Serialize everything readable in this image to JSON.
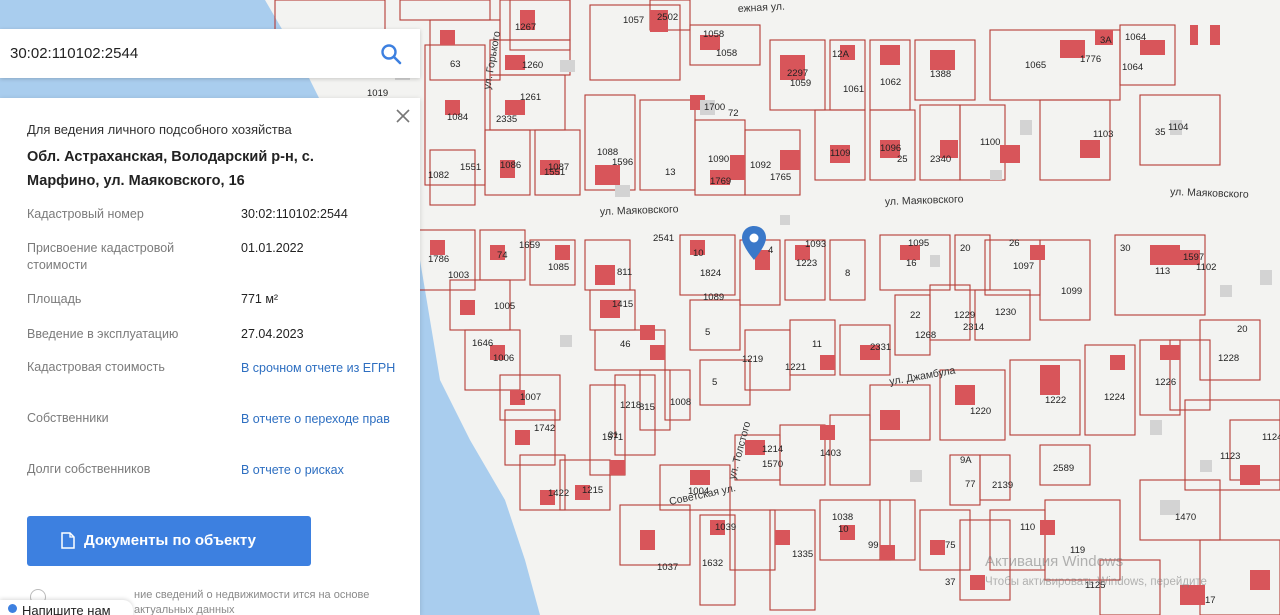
{
  "search": {
    "value": "30:02:110102:2544"
  },
  "parcel": {
    "purpose": "Для ведения личного подсобного хозяйства",
    "address": "Обл. Астраханская, Володарский р-н, с. Марфино, ул. Маяковского, 16",
    "rows": [
      {
        "label": "Кадастровый номер",
        "value": "30:02:110102:2544"
      },
      {
        "label": "Присвоение кадастровой стоимости",
        "value": "01.01.2022"
      },
      {
        "label": "Площадь",
        "value": "771 м²"
      },
      {
        "label": "Введение в эксплуатацию",
        "value": "27.04.2023"
      },
      {
        "label": "Кадастровая стоимость",
        "link": "В срочном отчете из ЕГРН"
      },
      {
        "label": "Собственники",
        "link": "В отчете о переходе прав"
      },
      {
        "label": "Долги собственников",
        "link": "В отчете о рисках"
      }
    ],
    "docs_button": "Документы по объекту",
    "footnote": "ние сведений о недвижимости ится на основе актуальных данных"
  },
  "chat": {
    "label": "Напишите нам"
  },
  "watermark": {
    "line1": "Активация Windows",
    "line2": "Чтобы активировать Windows, перейдите"
  },
  "map": {
    "streets": [
      "ул. Маяковского",
      "ул. Маяковского",
      "ул. Маяковского",
      "ул. Джамбула",
      "Советская ул.",
      "ул. Толстого",
      "ул. Горького",
      "ежная ул."
    ],
    "parcels": [
      "1057",
      "2502",
      "1058",
      "1058",
      "12А",
      "2297",
      "1059",
      "1061",
      "1062",
      "1388",
      "1065",
      "1776",
      "3А",
      "1064",
      "1064",
      "1104",
      "35",
      "1103",
      "1100",
      "2340",
      "1096",
      "25",
      "1109",
      "1092",
      "1765",
      "1090",
      "1769",
      "1700",
      "72",
      "13",
      "1088",
      "1596",
      "1087",
      "1551",
      "1086",
      "2335",
      "1261",
      "1260",
      "1267",
      "63",
      "1084",
      "1551",
      "1082",
      "1019",
      "1003",
      "1786",
      "74",
      "1659",
      "1085",
      "811",
      "1415",
      "46",
      "2541",
      "10",
      "1824",
      "1089",
      "5",
      "5",
      "1219",
      "1221",
      "11",
      "1223",
      "1093",
      "8",
      "2331",
      "4",
      "16",
      "1095",
      "20",
      "22",
      "1229",
      "2314",
      "1268",
      "1230",
      "1097",
      "26",
      "1099",
      "30",
      "113",
      "1597",
      "1102",
      "1228",
      "20",
      "1226",
      "1224",
      "1222",
      "1220",
      "1123",
      "1124",
      "2589",
      "2139",
      "77",
      "9А",
      "1403",
      "1570",
      "1214",
      "1004",
      "1005",
      "1646",
      "1006",
      "1007",
      "1742",
      "1422",
      "1215",
      "1571",
      "31",
      "1218",
      "815",
      "1008",
      "1037",
      "1632",
      "1039",
      "1335",
      "1038",
      "10",
      "99",
      "75",
      "37",
      "110",
      "119",
      "1125",
      "17",
      "1470"
    ]
  }
}
